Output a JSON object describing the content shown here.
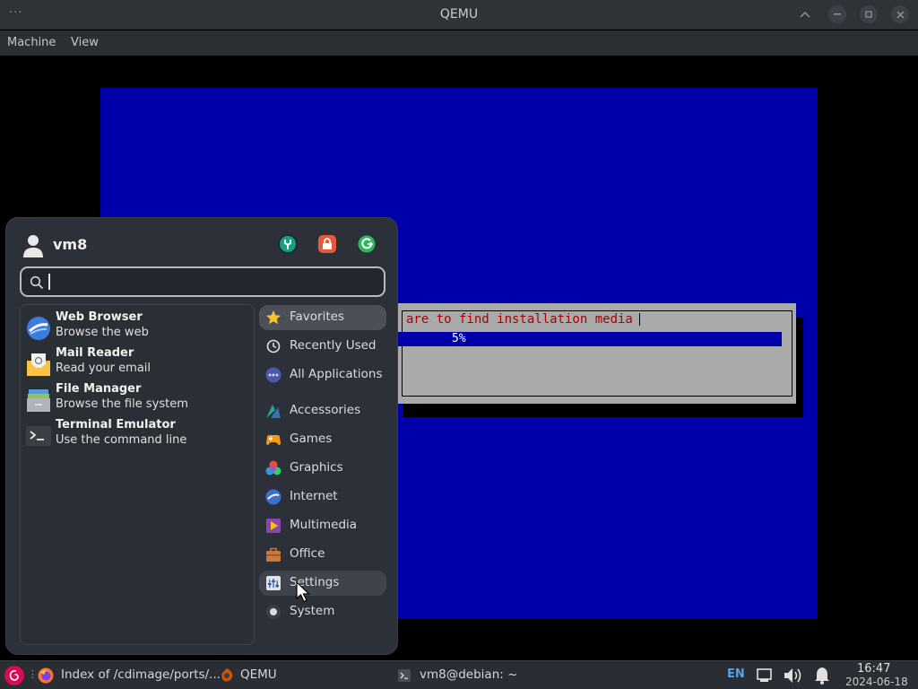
{
  "window": {
    "title": "QEMU",
    "dots": "···"
  },
  "menubar": {
    "items": [
      "Machine",
      "View"
    ]
  },
  "installer": {
    "dialog_title": "are to find installation media",
    "progress_text": "5%",
    "progress": 0.05,
    "colors": {
      "background": "#0000aa",
      "dialog": "#aaaaaa",
      "title": "#aa0000"
    }
  },
  "whisker": {
    "username": "vm8",
    "actions": [
      "settings-manager-icon",
      "lock-screen-icon",
      "log-out-icon"
    ],
    "search": {
      "placeholder": "",
      "value": ""
    },
    "apps": [
      {
        "name": "Web Browser",
        "desc": "Browse the web",
        "icon": "web-browser-icon"
      },
      {
        "name": "Mail Reader",
        "desc": "Read your email",
        "icon": "mail-reader-icon"
      },
      {
        "name": "File Manager",
        "desc": "Browse the file system",
        "icon": "file-manager-icon"
      },
      {
        "name": "Terminal Emulator",
        "desc": "Use the command line",
        "icon": "terminal-icon"
      }
    ],
    "categories": [
      {
        "label": "Favorites",
        "icon": "star-icon"
      },
      {
        "label": "Recently Used",
        "icon": "clock-icon"
      },
      {
        "label": "All Applications",
        "icon": "dots-icon"
      },
      {
        "label": "Accessories",
        "icon": "accessories-icon"
      },
      {
        "label": "Games",
        "icon": "gamepad-icon"
      },
      {
        "label": "Graphics",
        "icon": "graphics-icon"
      },
      {
        "label": "Internet",
        "icon": "internet-icon"
      },
      {
        "label": "Multimedia",
        "icon": "multimedia-icon"
      },
      {
        "label": "Office",
        "icon": "briefcase-icon"
      },
      {
        "label": "Settings",
        "icon": "settings-icon"
      },
      {
        "label": "System",
        "icon": "system-icon"
      }
    ],
    "selected_category": "Favorites",
    "hovered_category": "Settings"
  },
  "taskbar": {
    "firefox_task": "Index of /cdimage/ports/...",
    "qemu_task": "QEMU",
    "terminal_task": "vm8@debian: ~",
    "keyboard_layout": "EN",
    "time": "16:47",
    "date": "2024-06-18"
  }
}
